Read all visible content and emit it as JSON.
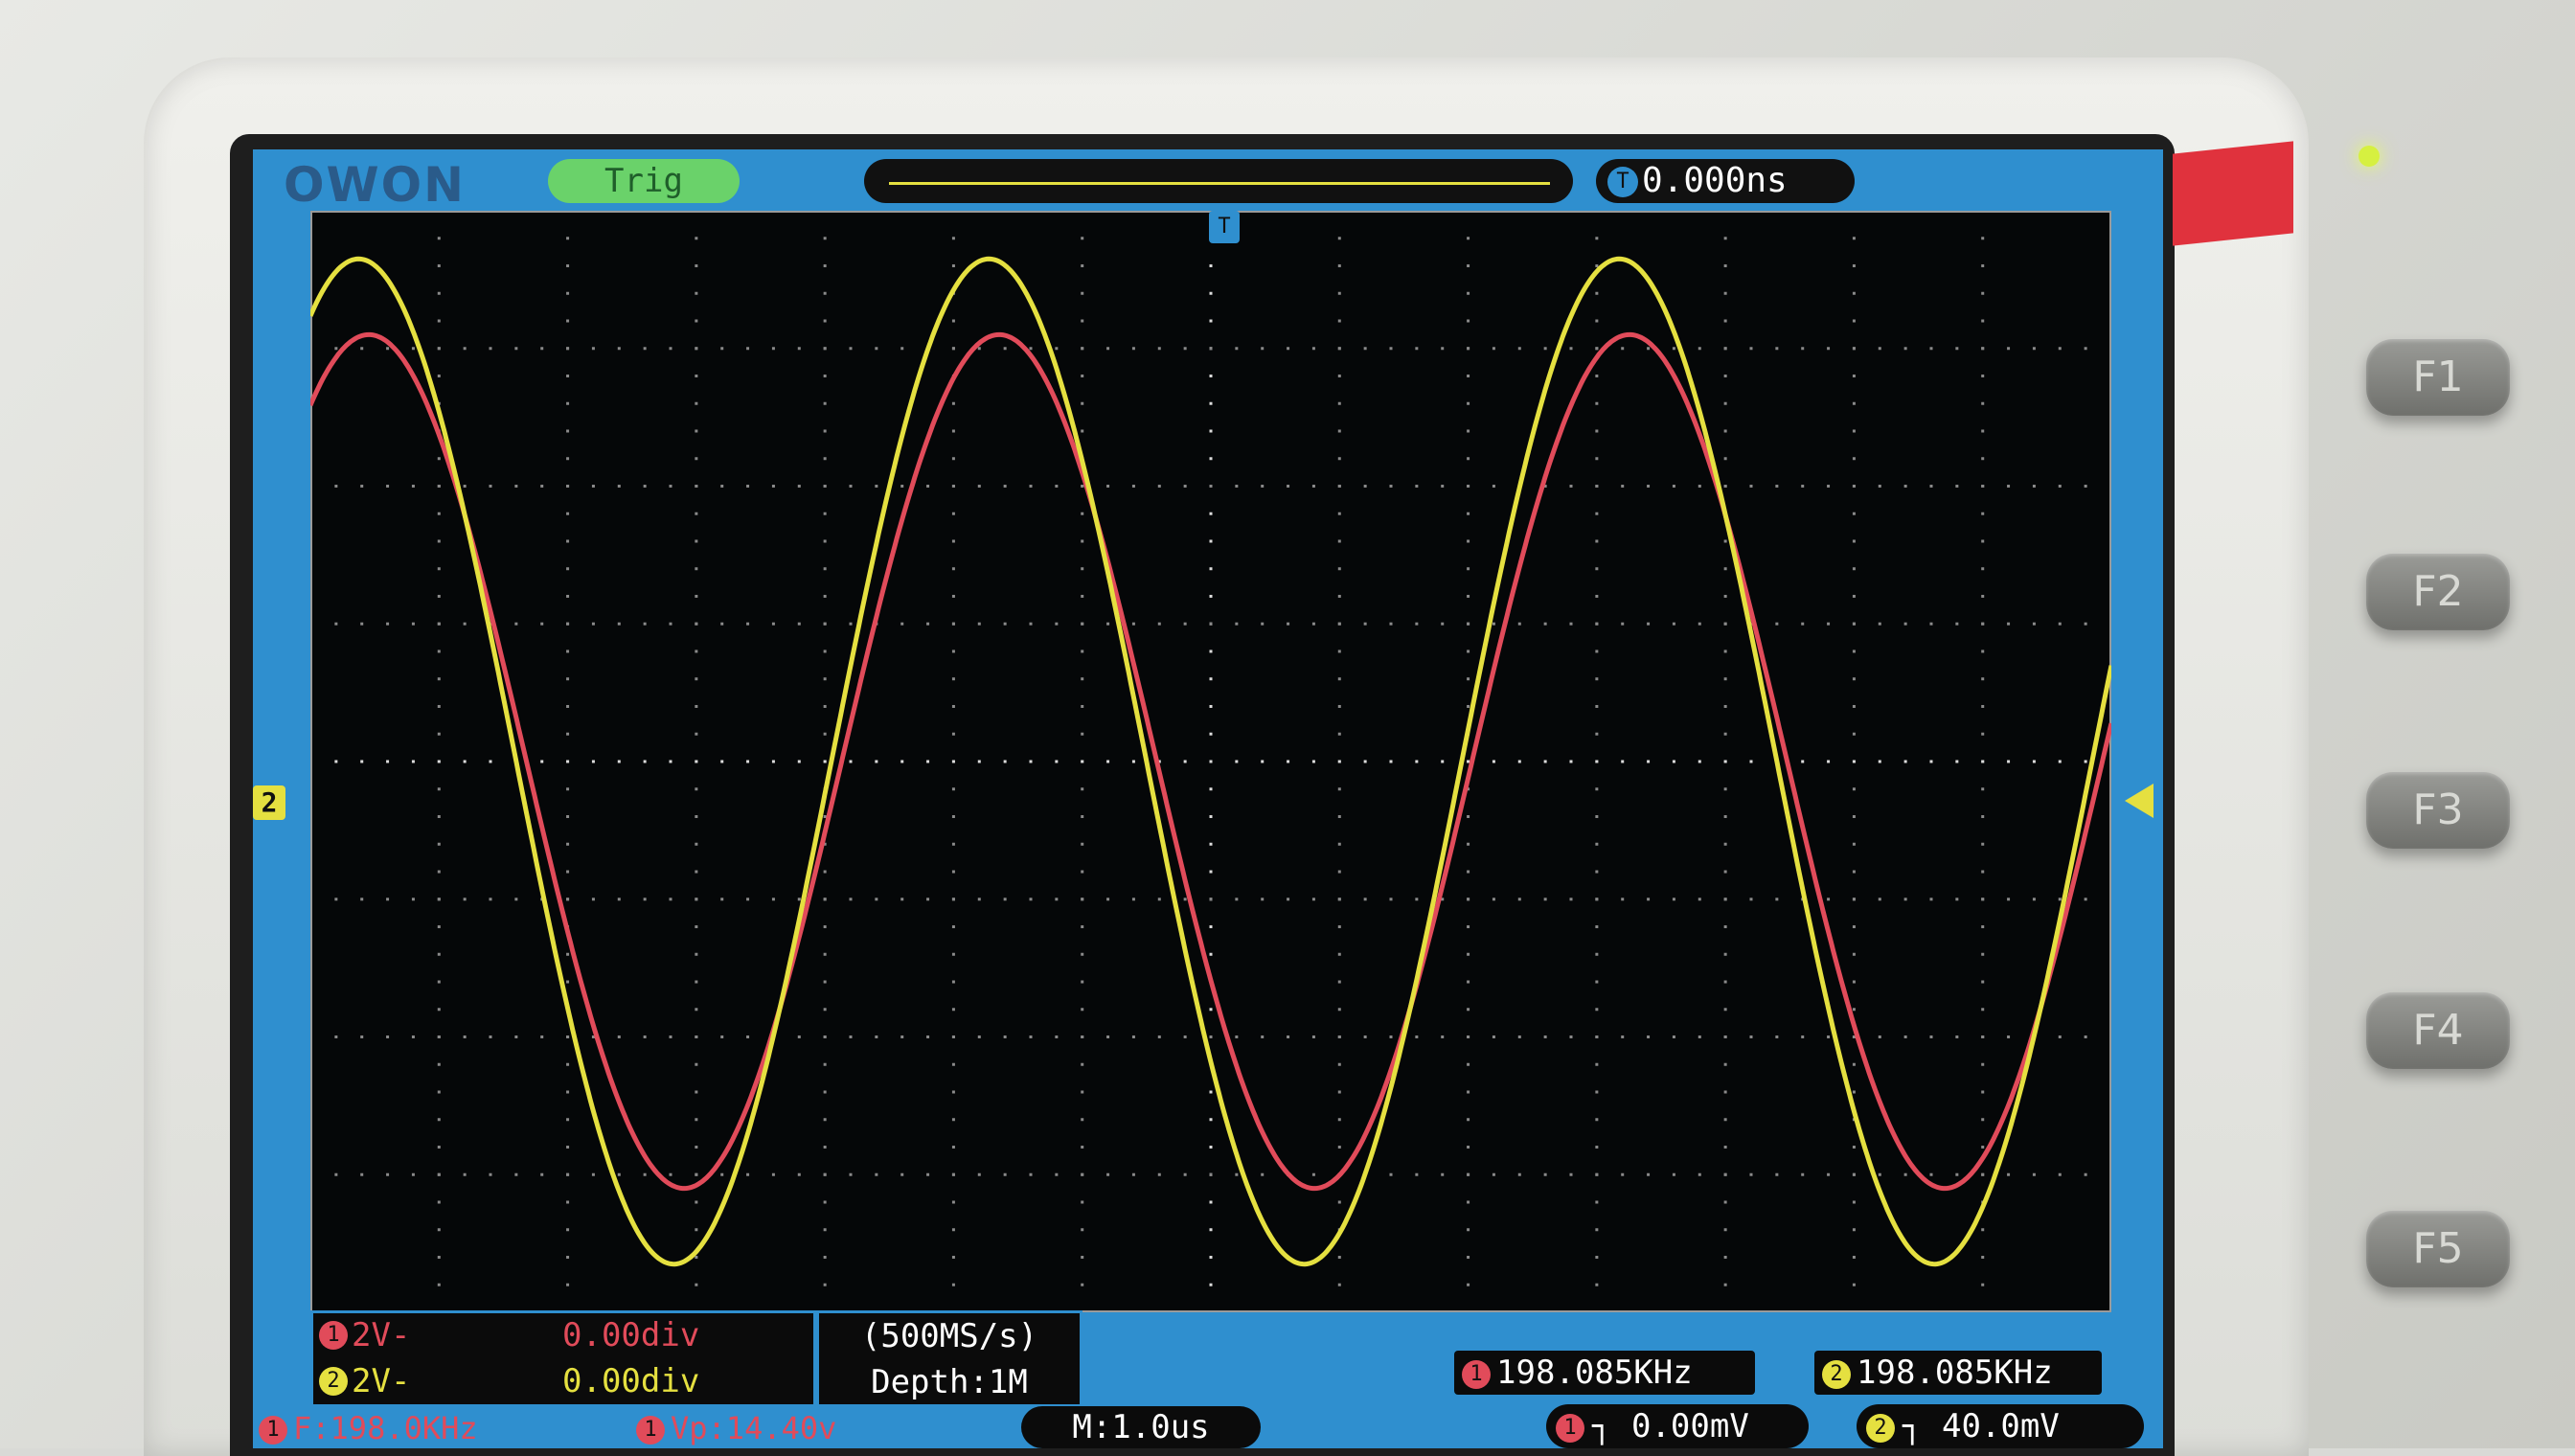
{
  "device": {
    "brand_logo": "OWON",
    "trigger_status": "Trig",
    "trigger_time_offset": "0.000ns",
    "ch2_marker": "2",
    "time_marker": "T"
  },
  "channels": [
    {
      "id": "1",
      "scale": "2V-",
      "position": "0.00div",
      "color": "#e14b5a",
      "frequency": "198.085KHz",
      "trigger_level": "0.00mV"
    },
    {
      "id": "2",
      "scale": "2V-",
      "position": "0.00div",
      "color": "#e5e040",
      "frequency": "198.085KHz",
      "trigger_level": "40.0mV"
    }
  ],
  "acquisition": {
    "sample_rate": "(500MS/s)",
    "depth": "Depth:1M",
    "timebase": "M:1.0us"
  },
  "measurements": {
    "freq": "F:198.0KHz",
    "vpp": "Vp:14.40v"
  },
  "function_keys": [
    "F1",
    "F2",
    "F3",
    "F4",
    "F5"
  ],
  "chart_data": {
    "type": "line",
    "grid": true,
    "xlim": [
      -7,
      7
    ],
    "ylim": [
      -4,
      4
    ],
    "series": [
      {
        "name": "",
        "color": "#e5e040",
        "amplitude_div": 3.65,
        "period_div": 4.9,
        "phase_div": -0.5
      },
      {
        "name": "",
        "color": "#e14b5a",
        "amplitude_div": 3.1,
        "period_div": 4.9,
        "phase_div": -0.42
      }
    ]
  }
}
